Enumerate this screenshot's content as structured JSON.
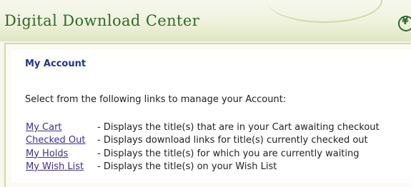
{
  "header": {
    "title": "Digital Download Center",
    "logo_icon": "circular-emblem-icon",
    "accent_color": "#2f6a2c"
  },
  "account": {
    "heading": "My Account",
    "intro": "Select from the following links to manage your Account:",
    "links": [
      {
        "label": "My Cart",
        "description": "- Displays the title(s) that are in your Cart awaiting checkout"
      },
      {
        "label": "Checked Out",
        "description": "- Displays download links for title(s) currently checked out"
      },
      {
        "label": "My Holds",
        "description": "- Displays the title(s) for which you are currently waiting"
      },
      {
        "label": "My Wish List",
        "description": "- Displays the title(s) on your Wish List"
      }
    ],
    "link_color": "#3d2f8e",
    "heading_color": "#22338a"
  }
}
